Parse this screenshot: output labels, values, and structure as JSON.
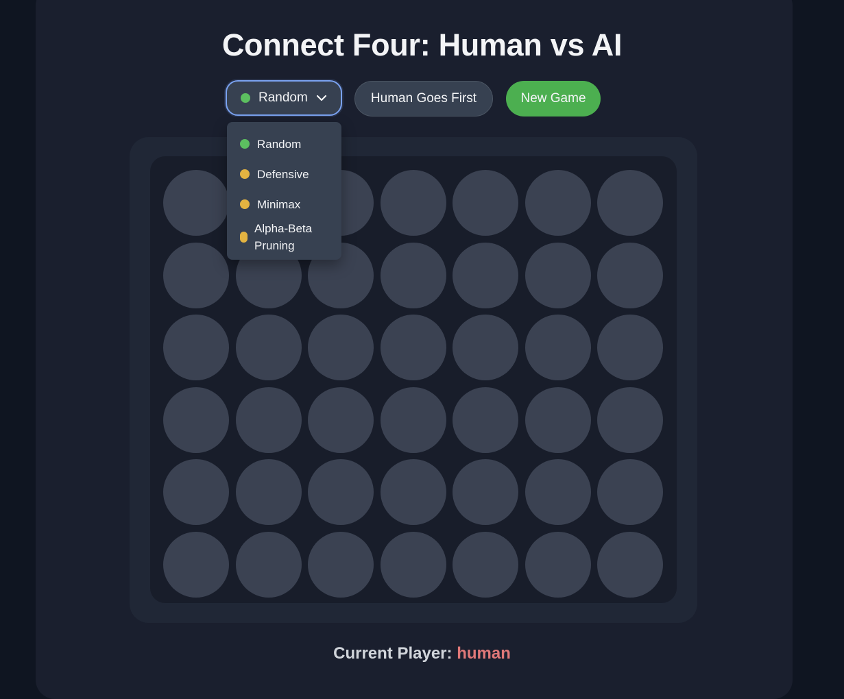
{
  "title": "Connect Four: Human vs AI",
  "controls": {
    "ai_selector": {
      "selected_label": "Random",
      "selected_dot_color": "#5cbf60",
      "chevron_icon": "chevron-down-icon",
      "options": [
        {
          "label": "Random",
          "dot_color": "#5cbf60"
        },
        {
          "label": "Defensive",
          "dot_color": "#e3b341"
        },
        {
          "label": "Minimax",
          "dot_color": "#e3b341"
        },
        {
          "label": "Alpha-Beta Pruning",
          "dot_color": "#e3b341"
        }
      ]
    },
    "first_player_label": "Human Goes First",
    "new_game_label": "New Game"
  },
  "board": {
    "rows": 6,
    "columns": 7,
    "cells": [
      [
        "",
        "",
        "",
        "",
        "",
        "",
        ""
      ],
      [
        "",
        "",
        "",
        "",
        "",
        "",
        ""
      ],
      [
        "",
        "",
        "",
        "",
        "",
        "",
        ""
      ],
      [
        "",
        "",
        "",
        "",
        "",
        "",
        ""
      ],
      [
        "",
        "",
        "",
        "",
        "",
        "",
        ""
      ],
      [
        "",
        "",
        "",
        "",
        "",
        "",
        ""
      ]
    ],
    "empty_color": "#3b4252"
  },
  "status": {
    "prefix": "Current Player: ",
    "player": "human",
    "player_color": "#e07878"
  },
  "colors": {
    "accent_focus": "#7aa2f0",
    "new_game_green": "#4caf50"
  }
}
